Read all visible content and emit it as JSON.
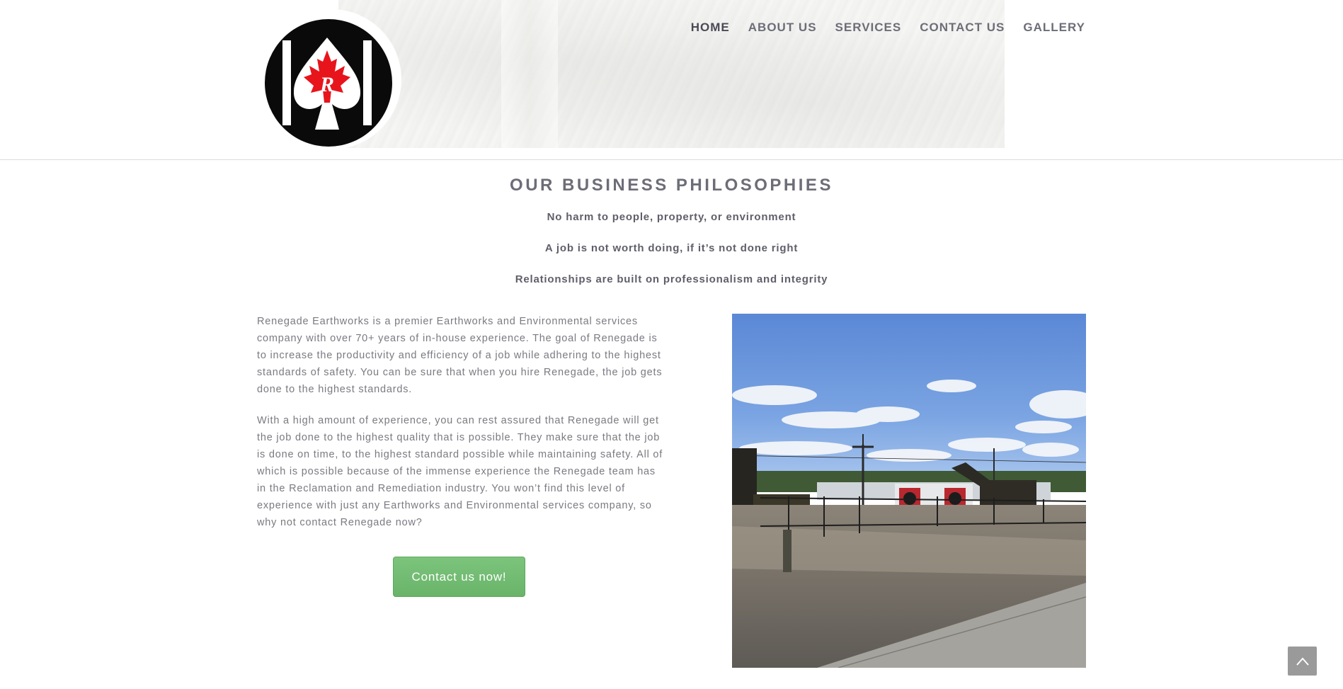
{
  "nav": {
    "items": [
      {
        "label": "HOME",
        "active": true
      },
      {
        "label": "ABOUT US",
        "active": false
      },
      {
        "label": "SERVICES",
        "active": false
      },
      {
        "label": "CONTACT US",
        "active": false
      },
      {
        "label": "GALLERY",
        "active": false
      }
    ]
  },
  "logo": {
    "letter": "R",
    "icon": "spade-maple-leaf-logo"
  },
  "philosophies": {
    "title": "OUR BUSINESS PHILOSOPHIES",
    "lines": [
      "No harm to people, property, or environment",
      "A job is not worth doing, if it’s not done right",
      "Relationships are built on professionalism and integrity"
    ]
  },
  "intro": {
    "paragraph1": "Renegade Earthworks is a premier Earthworks and Environmental services company with over 70+ years of in-house experience.  The goal of Renegade is to increase the productivity and efficiency of a job while adhering to the highest standards of safety. You can be sure that when you hire Renegade, the job gets done to the highest standards.",
    "paragraph2": "With a high amount of experience, you can rest assured that Renegade will get the job done to the highest quality that is possible. They make sure that the job is done on time, to the highest standard possible while maintaining safety. All of which is possible because of the immense experience the Renegade team has in the Reclamation and Remediation industry. You won’t find this level of experience with just any Earthworks and Environmental services company, so why not contact Renegade now?"
  },
  "cta": {
    "label": "Contact us now!"
  },
  "scroll_top": {
    "icon": "chevron-up-icon"
  },
  "colors": {
    "nav_text": "#6d6d78",
    "cta_green": "#6ab46a",
    "body_text": "#7a7a82",
    "logo_red": "#e8141c"
  }
}
